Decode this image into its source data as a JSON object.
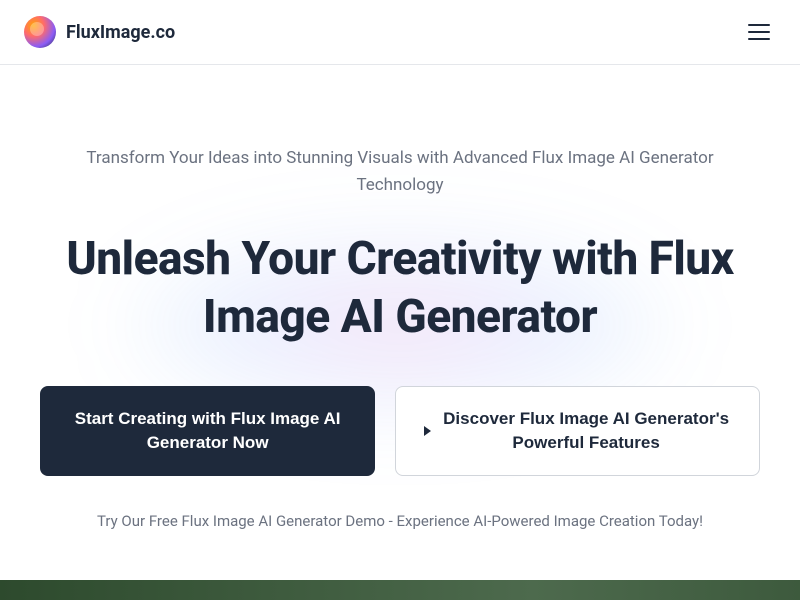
{
  "header": {
    "logo_text": "FluxImage.co"
  },
  "hero": {
    "subtitle": "Transform Your Ideas into Stunning Visuals with Advanced Flux Image AI Generator Technology",
    "heading": "Unleash Your Creativity with Flux Image AI Generator",
    "primary_cta": "Start Creating with Flux Image AI Generator Now",
    "secondary_cta": "Discover Flux Image AI Generator's Powerful Features",
    "demo_text": "Try Our Free Flux Image AI Generator Demo - Experience AI-Powered Image Creation Today!"
  }
}
